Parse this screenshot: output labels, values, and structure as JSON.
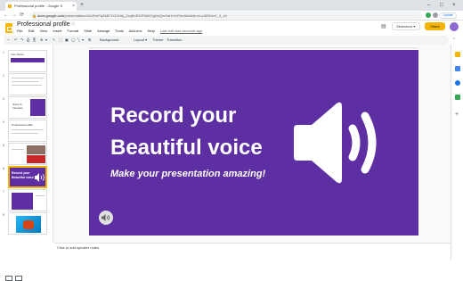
{
  "browser": {
    "tab_title": "Professional profile - Google S",
    "tab_close": "×",
    "new_tab": "+",
    "window_controls": [
      "–",
      "□",
      "×"
    ],
    "url_host": "docs.google.com",
    "url_path": "/presentation/d/1vRmPqZkB7YGXHhj_ZxqBoRGFNtMOgNnQxrSaHrXvR/edit#slide=id.p3lRh4e1_0_44",
    "nav": {
      "back": "←",
      "forward": "→",
      "reload": "⟳"
    },
    "update_label": "Update"
  },
  "app": {
    "doc_title": "Professional profile",
    "menus": [
      "File",
      "Edit",
      "View",
      "Insert",
      "Format",
      "Slide",
      "Arrange",
      "Tools",
      "Add-ons",
      "Help"
    ],
    "last_edit": "Last edit was seconds ago",
    "slideshow_label": "Slideshow",
    "share_label": "Share",
    "accent_color": "#f4b400"
  },
  "toolbar": {
    "background_label": "Background",
    "layout_label": "Layout ▾",
    "theme_label": "Theme",
    "transition_label": "Transition",
    "icons": [
      "+",
      "↶",
      "↷",
      "⎙",
      "⎘",
      "⊕",
      "▾",
      "↖",
      "⬚",
      "▣",
      "◯",
      "╲",
      "▾",
      "⊞"
    ]
  },
  "filmstrip": {
    "numbers": [
      "1",
      "2",
      "3",
      "4",
      "5",
      "6",
      "7",
      "8"
    ],
    "thumb1_title": "Your Name",
    "thumb3_title": "Some & Interests",
    "thumb4_title": "Professional skills",
    "thumb6_title": "Record your Beautiful voice"
  },
  "slide": {
    "line1": "Record your",
    "line2": "Beautiful voice",
    "subtitle": "Make your presentation amazing!",
    "background_color": "#5e2ea3"
  },
  "notes_placeholder": "Click to add speaker notes"
}
